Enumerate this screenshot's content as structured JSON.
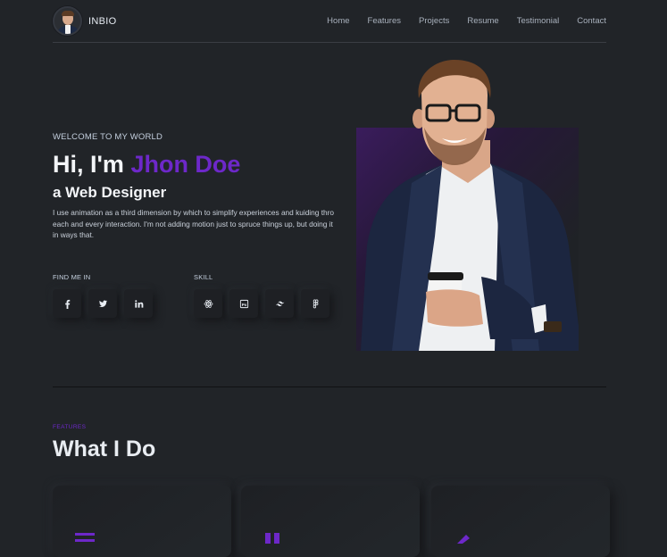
{
  "header": {
    "brand": "INBIO",
    "nav": [
      "Home",
      "Features",
      "Projects",
      "Resume",
      "Testimonial",
      "Contact"
    ]
  },
  "hero": {
    "welcome": "WELCOME TO MY WORLD",
    "greeting": "Hi, I'm ",
    "name": "Jhon Doe",
    "role": "a Web Designer",
    "description": "I use animation as a third dimension by which to simplify experiences and kuiding thro each and every interaction. I'm not adding motion just to spruce things up, but doing it in ways that."
  },
  "find_me": {
    "label": "FIND ME IN",
    "icons": [
      "facebook-icon",
      "twitter-icon",
      "linkedin-icon"
    ]
  },
  "skill": {
    "label": "SKILL",
    "icons": [
      "react-icon",
      "photoshop-icon",
      "tailwind-icon",
      "figma-icon"
    ]
  },
  "features": {
    "label": "FEATURES",
    "title": "What I Do"
  },
  "colors": {
    "accent": "#6d28c9",
    "background": "#212428"
  }
}
